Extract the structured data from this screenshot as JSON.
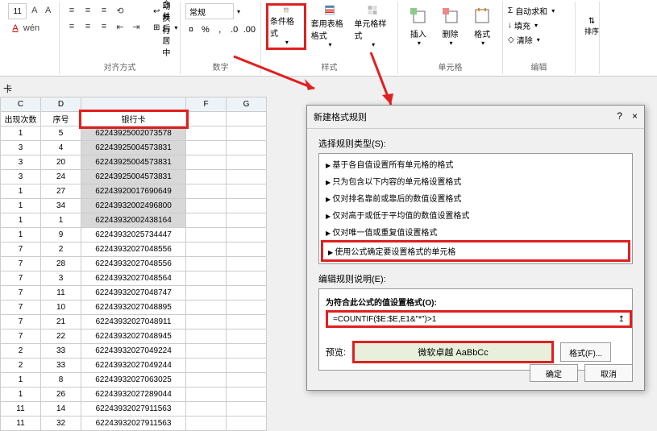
{
  "ribbon": {
    "font_size": "11",
    "wrap_label": "自动换行",
    "merge_label": "合并后居中",
    "align_section": "对齐方式",
    "number_format": "常规",
    "number_section": "数字",
    "cond_format_label": "条件格式",
    "table_format_label": "套用表格格式",
    "cell_style_label": "单元格样式",
    "styles_section": "样式",
    "insert_label": "插入",
    "delete_label": "删除",
    "format_label": "格式",
    "cells_section": "单元格",
    "autosum_label": "自动求和",
    "fill_label": "填充",
    "clear_label": "清除",
    "edit_section": "编辑",
    "sort_label": "排序"
  },
  "sheet": {
    "namebox": "卡",
    "col_headers": [
      "C",
      "D",
      "",
      "F",
      "G"
    ],
    "headers": {
      "c": "出现次数",
      "d": "序号",
      "e": "银行卡"
    },
    "rows": [
      {
        "c": "1",
        "d": "5",
        "e": "62243925002073578"
      },
      {
        "c": "3",
        "d": "4",
        "e": "62243925004573831"
      },
      {
        "c": "3",
        "d": "20",
        "e": "62243925004573831"
      },
      {
        "c": "3",
        "d": "24",
        "e": "62243925004573831"
      },
      {
        "c": "1",
        "d": "27",
        "e": "62243920017690649"
      },
      {
        "c": "1",
        "d": "34",
        "e": "62243932002496800"
      },
      {
        "c": "1",
        "d": "1",
        "e": "62243932002438164"
      },
      {
        "c": "1",
        "d": "9",
        "e": "62243932025734447"
      },
      {
        "c": "7",
        "d": "2",
        "e": "62243932027048556"
      },
      {
        "c": "7",
        "d": "28",
        "e": "62243932027048556"
      },
      {
        "c": "7",
        "d": "3",
        "e": "62243932027048564"
      },
      {
        "c": "7",
        "d": "11",
        "e": "62243932027048747"
      },
      {
        "c": "7",
        "d": "10",
        "e": "62243932027048895"
      },
      {
        "c": "7",
        "d": "21",
        "e": "62243932027048911"
      },
      {
        "c": "7",
        "d": "22",
        "e": "62243932027048945"
      },
      {
        "c": "2",
        "d": "33",
        "e": "62243932027049224"
      },
      {
        "c": "2",
        "d": "33",
        "e": "62243932027049244"
      },
      {
        "c": "1",
        "d": "8",
        "e": "62243932027063025"
      },
      {
        "c": "1",
        "d": "26",
        "e": "62243932027289044"
      },
      {
        "c": "11",
        "d": "14",
        "e": "62243932027911563"
      },
      {
        "c": "11",
        "d": "32",
        "e": "62243932027911563"
      }
    ]
  },
  "dialog": {
    "title": "新建格式规则",
    "help": "?",
    "close": "×",
    "select_type_label": "选择规则类型(S):",
    "rules": [
      "基于各自值设置所有单元格的格式",
      "只为包含以下内容的单元格设置格式",
      "仅对排名靠前或靠后的数值设置格式",
      "仅对高于或低于平均值的数值设置格式",
      "仅对唯一值或重复值设置格式",
      "使用公式确定要设置格式的单元格"
    ],
    "edit_desc_label": "编辑规则说明(E):",
    "formula_label": "为符合此公式的值设置格式(O):",
    "formula": "=COUNTIF($E:$E,E1&\"*\")>1",
    "preview_label": "预览:",
    "preview_text": "微软卓越 AaBbCc",
    "format_btn": "格式(F)...",
    "ok": "确定",
    "cancel": "取消"
  }
}
